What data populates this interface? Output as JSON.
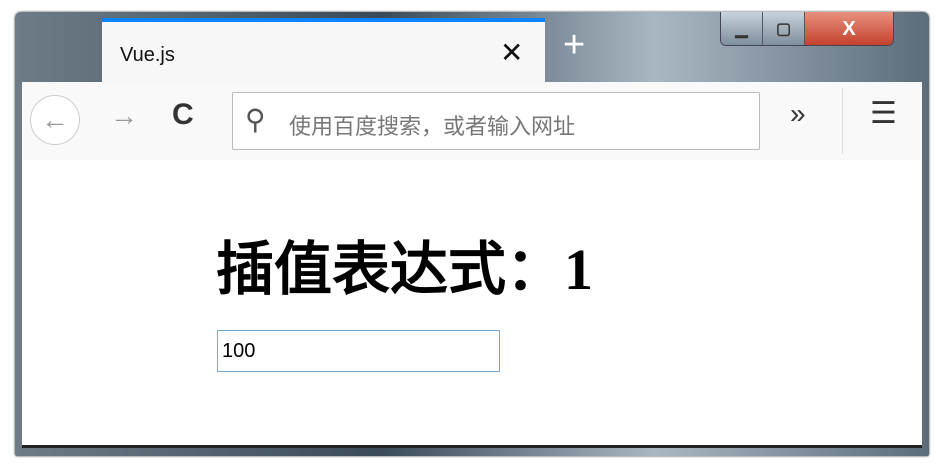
{
  "browser": {
    "tab_title": "Vue.js",
    "close_tab": "✕",
    "new_tab": "+",
    "minimize": "▁",
    "maximize": "▢",
    "close_window": "X"
  },
  "toolbar": {
    "back": "←",
    "forward": "→",
    "reload": "C",
    "search_icon": "search-icon",
    "url_placeholder": "使用百度搜索，或者输入网址",
    "overflow": "»",
    "menu": "☰"
  },
  "page": {
    "heading": "插值表达式：1",
    "input_value": "100"
  }
}
